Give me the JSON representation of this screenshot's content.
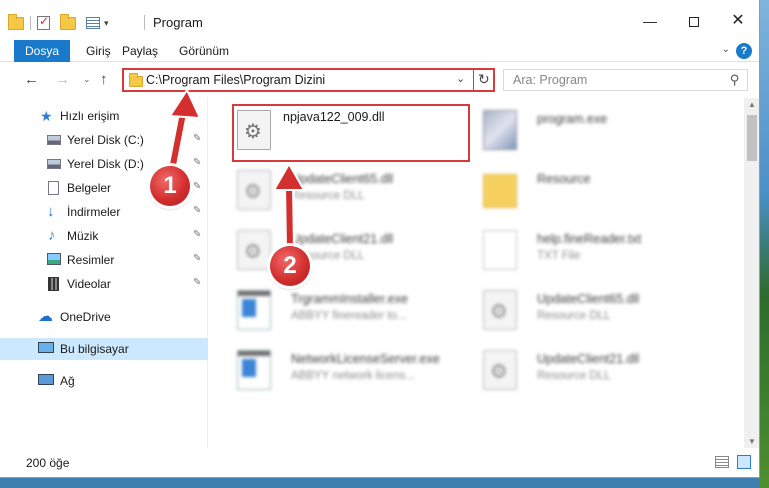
{
  "window": {
    "title": "Program",
    "controls": {
      "minimize": "—",
      "close": "✕"
    }
  },
  "ribbon": {
    "tabs": [
      "Dosya",
      "Giriş",
      "Paylaş",
      "Görünüm"
    ],
    "expand": "⌄",
    "help": "?"
  },
  "nav": {
    "back": "←",
    "forward": "→",
    "recent": "⌄",
    "up": "↑",
    "address": "C:\\Program Files\\Program Dizini",
    "address_dropdown": "⌄",
    "refresh": "↻",
    "search_placeholder": "Ara: Program",
    "search_icon": "⚲"
  },
  "sidebar": {
    "items": [
      {
        "label": "Hızlı erişim",
        "icon": "star-icon",
        "pinned": false
      },
      {
        "label": "Yerel Disk (C:)",
        "icon": "disk-icon",
        "pinned": true
      },
      {
        "label": "Yerel Disk (D:)",
        "icon": "disk-icon",
        "pinned": true
      },
      {
        "label": "Belgeler",
        "icon": "document-icon",
        "pinned": true
      },
      {
        "label": "İndirmeler",
        "icon": "download-icon",
        "pinned": true
      },
      {
        "label": "Müzik",
        "icon": "music-icon",
        "pinned": true
      },
      {
        "label": "Resimler",
        "icon": "pictures-icon",
        "pinned": true
      },
      {
        "label": "Videolar",
        "icon": "video-icon",
        "pinned": true
      },
      {
        "label": "OneDrive",
        "icon": "cloud-icon",
        "pinned": false
      },
      {
        "label": "Bu bilgisayar",
        "icon": "computer-icon",
        "pinned": false,
        "selected": true
      },
      {
        "label": "Ağ",
        "icon": "network-icon",
        "pinned": false
      }
    ],
    "pin_glyph": "📌"
  },
  "files": [
    {
      "name": "npjava122_009.dll",
      "type": "",
      "icon": "dll-icon",
      "highlighted": true
    },
    {
      "name": "program.exe",
      "type": "",
      "icon": "program-icon",
      "blurred": true
    },
    {
      "name": "UpdateClient65.dll",
      "type": "Resource DLL",
      "icon": "dll-icon",
      "blurred": true
    },
    {
      "name": "Resource",
      "type": "",
      "icon": "folder-icon",
      "blurred": true
    },
    {
      "name": "UpdateClient21.dll",
      "type": "Resource DLL",
      "icon": "dll-icon",
      "blurred": true
    },
    {
      "name": "help.fineReader.txt",
      "type": "TXT File",
      "icon": "text-file-icon",
      "blurred": true
    },
    {
      "name": "TrgrammInstaller.exe",
      "type": "ABBYY finereader to...",
      "icon": "exe-icon",
      "blurred": true
    },
    {
      "name": "UpdateClient65.dll",
      "type": "Resource DLL",
      "icon": "dll-icon",
      "blurred": true
    },
    {
      "name": "NetworkLicenseServer.exe",
      "type": "ABBYY network licens...",
      "icon": "exe-icon",
      "blurred": true
    },
    {
      "name": "UpdateClient21.dll",
      "type": "Resource DLL",
      "icon": "dll-icon",
      "blurred": true
    }
  ],
  "status": {
    "item_count": "200 öğe"
  },
  "annotations": {
    "step_1": "1",
    "step_2": "2",
    "color": "#d32f2f"
  }
}
